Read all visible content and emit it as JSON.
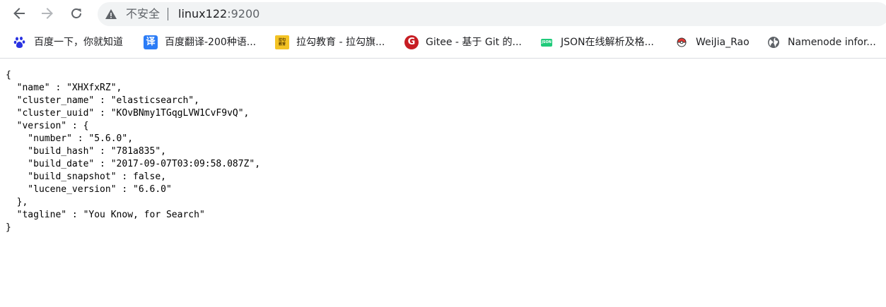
{
  "browser": {
    "security_label": "不安全",
    "url_host": "linux122",
    "url_port": ":9200"
  },
  "bookmarks": [
    {
      "label": "百度一下，你就知道",
      "icon": "baidu-paw-icon"
    },
    {
      "label": "百度翻译-200种语...",
      "icon": "baidu-translate-icon",
      "icon_text": "译"
    },
    {
      "label": "拉勾教育 - 拉勾旗...",
      "icon": "lagou-icon",
      "icon_text": "拉勾教育"
    },
    {
      "label": "Gitee - 基于 Git 的...",
      "icon": "gitee-icon",
      "icon_text": "G"
    },
    {
      "label": "JSON在线解析及格...",
      "icon": "json-icon",
      "icon_text": "JSON"
    },
    {
      "label": "WeiJia_Rao",
      "icon": "pokeball-icon"
    },
    {
      "label": "Namenode infor...",
      "icon": "globe-icon"
    }
  ],
  "response": {
    "name": "XHXfxRZ",
    "cluster_name": "elasticsearch",
    "cluster_uuid": "KOvBNmy1TGqgLVW1CvF9vQ",
    "version": {
      "number": "5.6.0",
      "build_hash": "781a835",
      "build_date": "2017-09-07T03:09:58.087Z",
      "build_snapshot": "false",
      "lucene_version": "6.6.0"
    },
    "tagline": "You Know, for Search"
  },
  "colors": {
    "omnibox_bg": "#f1f3f4",
    "icon_gray": "#5f6368",
    "baidu_blue": "#2932e1",
    "translate_blue": "#2b7cf6",
    "lagou_yellow": "#f3c325",
    "gitee_red": "#c71d23",
    "json_green": "#1fca7a"
  }
}
